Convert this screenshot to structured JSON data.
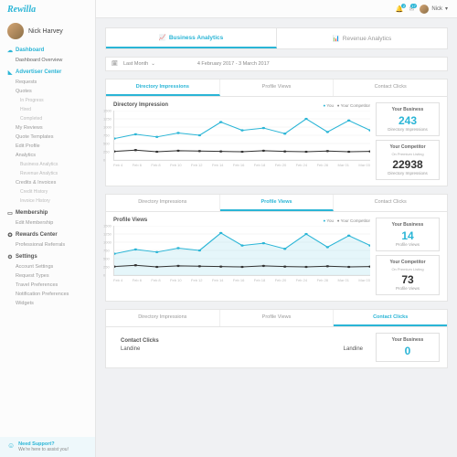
{
  "brand": "Rewilla",
  "user": {
    "name": "Nick Harvey",
    "short": "Nick"
  },
  "notifications": {
    "bell": "2",
    "mail": "17"
  },
  "sidebar": {
    "dashboard": {
      "head": "Dashboard",
      "items": [
        "Dashboard Overview"
      ]
    },
    "advertiser": {
      "head": "Advertiser Center",
      "items": [
        "Requests",
        "Quotes",
        "In Progress",
        "Hired",
        "Completed",
        "My Reviews",
        "Quote Templates",
        "Edit Profile",
        "Analytics",
        "Business Analytics",
        "Revenue Analytics",
        "Credits & Invoices",
        "Credit History",
        "Invoice History"
      ]
    },
    "membership": {
      "head": "Membership",
      "items": [
        "Edit Membership"
      ]
    },
    "rewards": {
      "head": "Rewards Center",
      "items": [
        "Professional Referrals"
      ]
    },
    "settings": {
      "head": "Settings",
      "items": [
        "Account Settings",
        "Request Types",
        "Travel Preferences",
        "Notification Preferences",
        "Widgets"
      ]
    }
  },
  "support": {
    "title": "Need Support?",
    "sub": "We're here to assist you!"
  },
  "atabs": {
    "a": "Business Analytics",
    "b": "Revenue Analytics"
  },
  "daterange": {
    "preset": "Last Month",
    "range": "4 February 2017 - 3 March 2017"
  },
  "ptabs": {
    "a": "Directory Impressions",
    "b": "Profile Views",
    "c": "Contact Clicks"
  },
  "legend": {
    "you": "You",
    "comp": "Your Competitor"
  },
  "panel1": {
    "title": "Directory Impression",
    "you": {
      "label": "Your Business",
      "val": "243",
      "unit": "Directory Impressions"
    },
    "comp": {
      "label": "Your Competitor",
      "sub": "On Premium Listing",
      "val": "22938",
      "unit": "Directory Impressions"
    }
  },
  "panel2": {
    "title": "Profile Views",
    "you": {
      "label": "Your Business",
      "val": "14",
      "unit": "Profile Views"
    },
    "comp": {
      "label": "Your Competitor",
      "sub": "On Premium Listing",
      "val": "73",
      "unit": "Profile Views"
    }
  },
  "panel3": {
    "title": "Contact Clicks",
    "row": "Landine",
    "you": {
      "label": "Your Business",
      "val": "0"
    }
  },
  "chart_data": [
    {
      "type": "line",
      "title": "Directory Impression",
      "ylim": [
        0,
        1500
      ],
      "yticks": [
        0,
        250,
        500,
        750,
        1000,
        1250,
        1500
      ],
      "categories": [
        "Feb 4",
        "Feb 6",
        "Feb 8",
        "Feb 10",
        "Feb 12",
        "Feb 14",
        "Feb 16",
        "Feb 18",
        "Feb 20",
        "Feb 24",
        "Feb 28",
        "Mar 01",
        "Mar 03"
      ],
      "series": [
        {
          "name": "You",
          "color": "#2ab5d6",
          "values": [
            650,
            780,
            700,
            820,
            750,
            1150,
            900,
            970,
            800,
            1250,
            850,
            1200,
            900
          ]
        },
        {
          "name": "Your Competitor",
          "color": "#333",
          "values": [
            260,
            300,
            250,
            280,
            270,
            260,
            250,
            280,
            260,
            250,
            270,
            250,
            260
          ]
        }
      ]
    },
    {
      "type": "line",
      "title": "Profile Views",
      "ylim": [
        0,
        1500
      ],
      "yticks": [
        0,
        250,
        500,
        750,
        1000,
        1250,
        1500
      ],
      "categories": [
        "Feb 4",
        "Feb 6",
        "Feb 8",
        "Feb 10",
        "Feb 12",
        "Feb 14",
        "Feb 16",
        "Feb 18",
        "Feb 20",
        "Feb 24",
        "Feb 28",
        "Mar 01",
        "Mar 03"
      ],
      "series": [
        {
          "name": "You",
          "color": "#2ab5d6",
          "fill": true,
          "values": [
            650,
            780,
            700,
            820,
            750,
            1280,
            900,
            970,
            800,
            1250,
            850,
            1200,
            900
          ]
        },
        {
          "name": "Your Competitor",
          "color": "#333",
          "values": [
            260,
            300,
            250,
            280,
            270,
            260,
            250,
            280,
            260,
            250,
            270,
            250,
            260
          ]
        }
      ]
    }
  ]
}
